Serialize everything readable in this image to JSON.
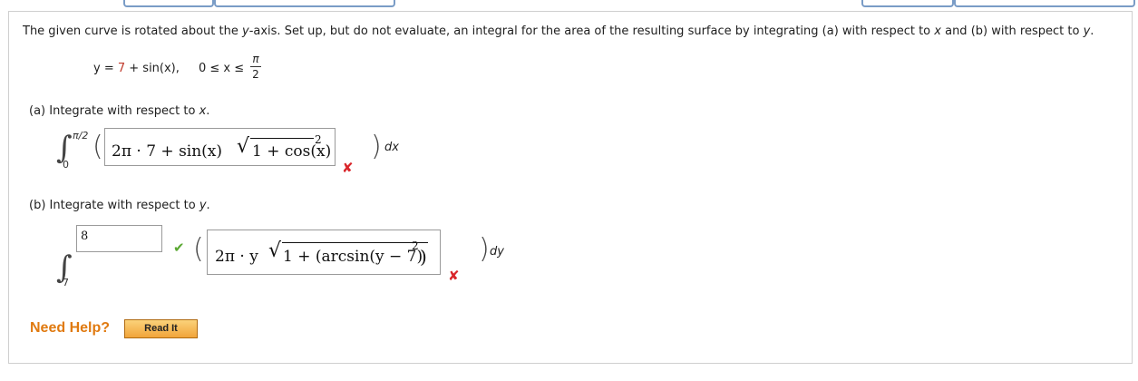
{
  "question": {
    "prompt_pre": "The given curve is rotated about the ",
    "axis_var": "y",
    "prompt_mid": "-axis. Set up, but do not evaluate, an integral for the area of the resulting surface by integrating (a) with respect to ",
    "x_var": "x",
    "prompt_mid2": " and (b) with respect to ",
    "y_var": "y",
    "prompt_end": ".",
    "curve_lhs": "y = ",
    "curve_num": "7",
    "curve_rhs": " + sin(x),",
    "domain_text": "0 ≤ x ≤",
    "pi_num": "π",
    "pi_den": "2"
  },
  "part_a": {
    "label_pre": "(a)  Integrate with respect to ",
    "label_var": "x",
    "label_end": ".",
    "upper_limit": "π/2",
    "lower_limit": "0",
    "answer_text": "2π · 7 + sin(x)",
    "answer_sqrt": "1 + cos(x)",
    "answer_exp": "2",
    "differential": "dx",
    "status_icon": "✘",
    "status_color": "#d9262b"
  },
  "part_b": {
    "label_pre": "(b)  Integrate with respect to ",
    "label_var": "y",
    "label_end": ".",
    "upper_limit_value": "8",
    "lower_limit": "7",
    "upper_status_icon": "✔",
    "upper_status_color": "#5aa832",
    "answer_text": "2π · y",
    "answer_sqrt": "1 + (arcsin(y − 7)",
    "answer_exp": "2",
    "answer_close": ")",
    "differential": "dy",
    "status_icon": "✘",
    "status_color": "#d9262b"
  },
  "help": {
    "label": "Need Help?",
    "read_it": "Read It"
  }
}
